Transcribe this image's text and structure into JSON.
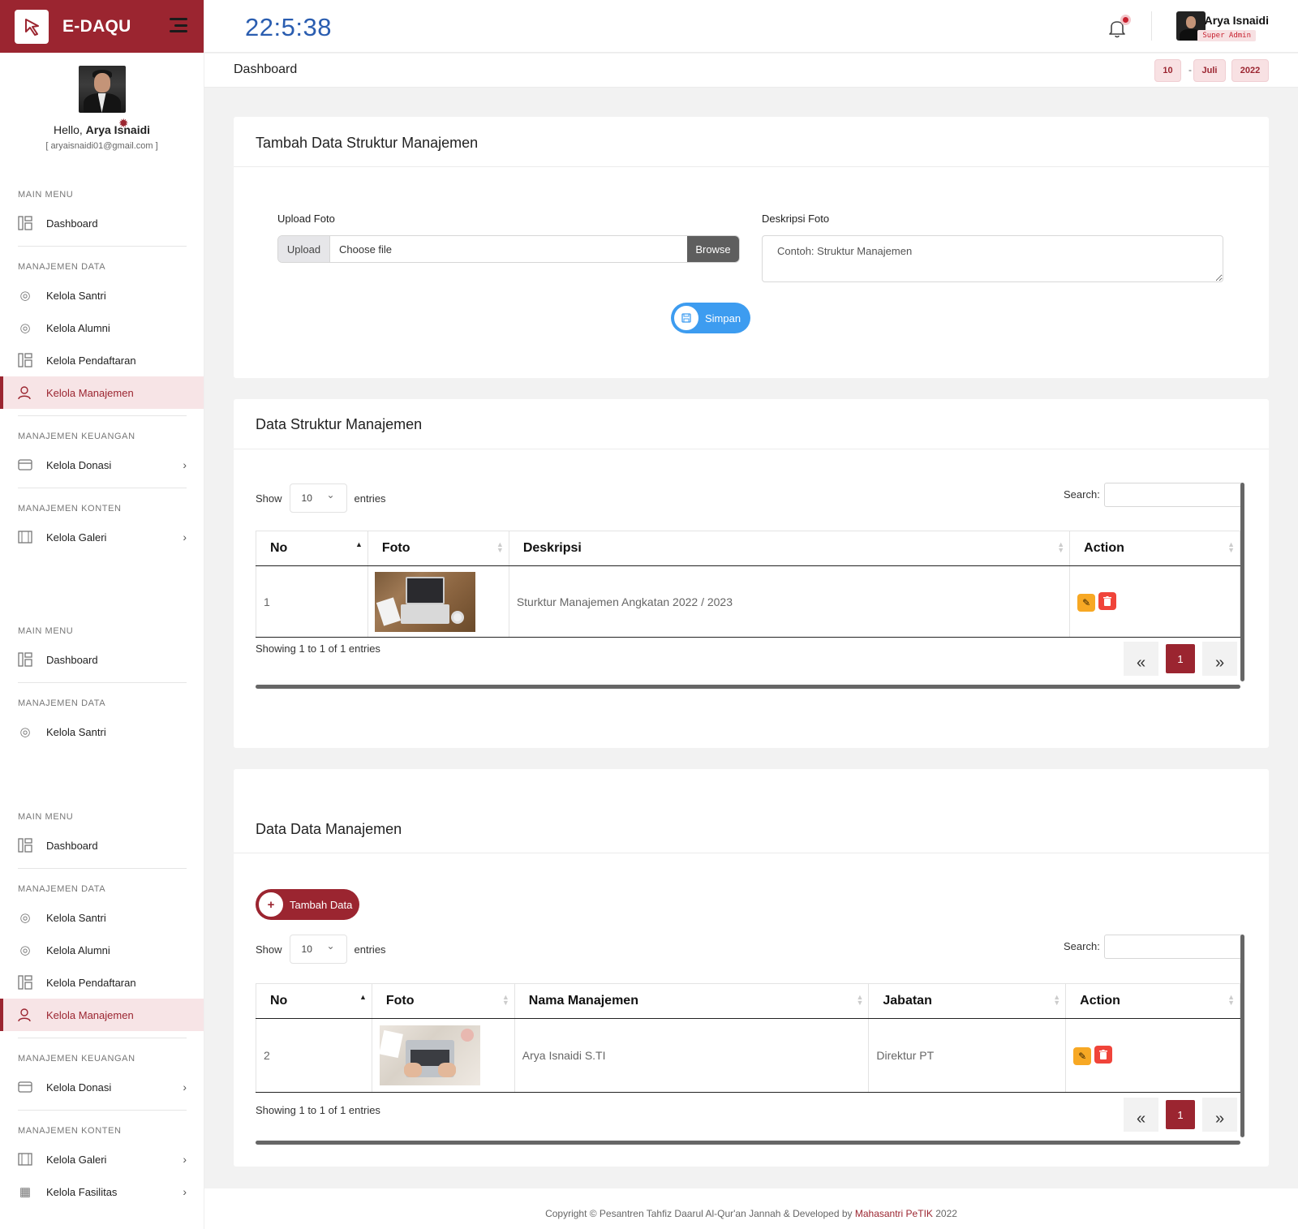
{
  "brand": {
    "name": "E-DAQU"
  },
  "header": {
    "clock": "22:5:38",
    "user_name": "Arya Isnaidi",
    "user_role": "Super Admin"
  },
  "subheader": {
    "breadcrumb": "Dashboard",
    "date_day": "10",
    "date_month": "Juli",
    "date_year": "2022",
    "date_sep": "-"
  },
  "sidebar": {
    "hello": "Hello,",
    "user_name": "Arya Isnaidi",
    "email": "[ aryaisnaidi01@gmail.com ]",
    "sections": {
      "main_menu": "MAIN MENU",
      "data": "MANAJEMEN DATA",
      "finance": "MANAJEMEN KEUANGAN",
      "content": "MANAJEMEN KONTEN"
    },
    "items": {
      "dashboard": "Dashboard",
      "santri": "Kelola Santri",
      "alumni": "Kelola Alumni",
      "pendaftaran": "Kelola Pendaftaran",
      "manajemen": "Kelola Manajemen",
      "donasi": "Kelola Donasi",
      "galeri": "Kelola Galeri",
      "fasilitas": "Kelola Fasilitas"
    }
  },
  "form_card": {
    "title": "Tambah Data Struktur Manajemen",
    "upload_label": "Upload Foto",
    "upload_btn": "Upload",
    "file_placeholder": "Choose file",
    "browse_btn": "Browse",
    "desc_label": "Deskripsi Foto",
    "desc_placeholder": "Contoh: Struktur Manajemen",
    "save_btn": "Simpan"
  },
  "struct_table": {
    "title": "Data Struktur Manajemen",
    "show": "Show",
    "entries_value": "10",
    "entries": "entries",
    "search": "Search:",
    "columns": [
      "No",
      "Foto",
      "Deskripsi",
      "Action"
    ],
    "rows": [
      {
        "no": "1",
        "deskripsi": "Sturktur Manajemen Angkatan 2022 / 2023"
      }
    ],
    "info": "Showing 1 to 1 of 1 entries",
    "page": "1",
    "prev": "«",
    "next": "»"
  },
  "mgmt_table": {
    "title": "Data Data Manajemen",
    "add_btn": "Tambah Data",
    "show": "Show",
    "entries_value": "10",
    "entries": "entries",
    "search": "Search:",
    "columns": [
      "No",
      "Foto",
      "Nama Manajemen",
      "Jabatan",
      "Action"
    ],
    "rows": [
      {
        "no": "2",
        "nama": "Arya Isnaidi S.TI",
        "jabatan": "Direktur PT"
      }
    ],
    "info": "Showing 1 to 1 of 1 entries",
    "page": "1",
    "prev": "«",
    "next": "»"
  },
  "footer": {
    "prefix": "Copyright © Pesantren Tahfiz Daarul Al-Qur'an Jannah & Developed by ",
    "highlight": "Mahasantri PeTIK",
    "suffix": " 2022"
  },
  "colors": {
    "brand": "#9b2530",
    "clock": "#2a5db0",
    "save": "#3d9cf0",
    "edit": "#f7a824",
    "delete": "#f0443a"
  }
}
